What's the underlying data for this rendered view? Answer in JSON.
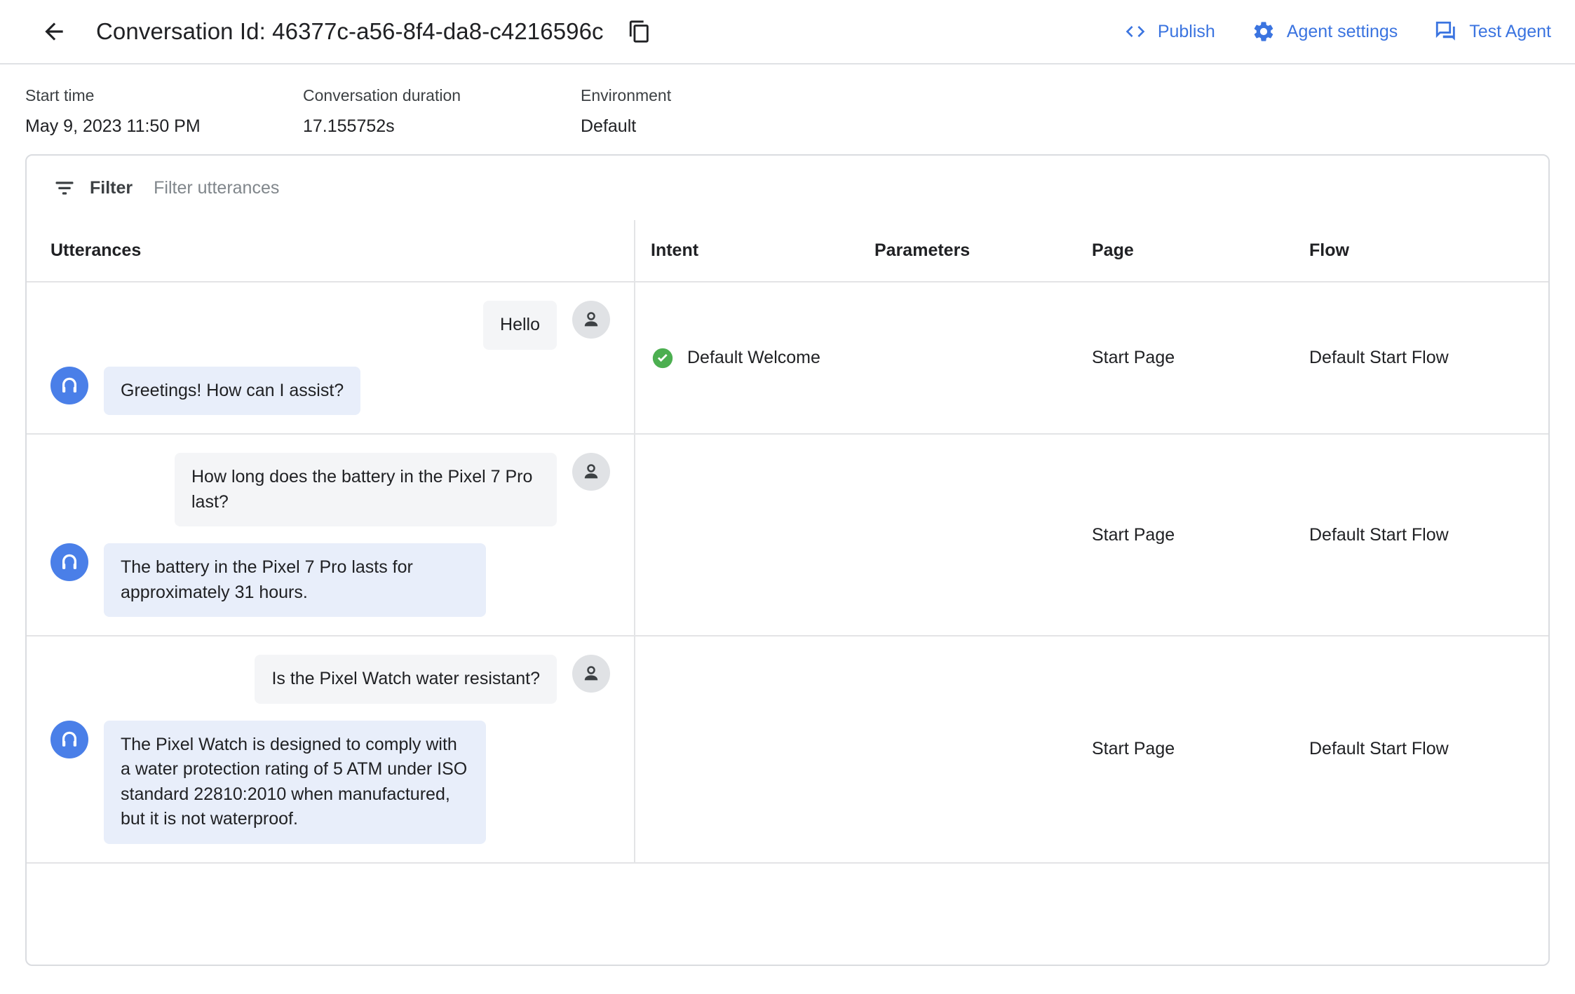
{
  "header": {
    "back_label": "Back",
    "title": "Conversation Id: 46377c-a56-8f4-da8-c4216596c",
    "copy_label": "Copy conversation id",
    "actions": [
      {
        "label": "Publish",
        "icon": "code-brackets-icon"
      },
      {
        "label": "Agent settings",
        "icon": "gear-icon"
      },
      {
        "label": "Test Agent",
        "icon": "chat-bubbles-icon"
      }
    ],
    "accent_color": "#3b74e0"
  },
  "meta": [
    {
      "label": "Start time",
      "value": "May 9, 2023 11:50 PM"
    },
    {
      "label": "Conversation duration",
      "value": "17.155752s"
    },
    {
      "label": "Environment",
      "value": "Default"
    }
  ],
  "filter": {
    "label": "Filter",
    "placeholder": "Filter utterances",
    "value": "",
    "icon": "filter-icon"
  },
  "table": {
    "columns": [
      "Utterances",
      "Intent",
      "Parameters",
      "Page",
      "Flow"
    ],
    "rows": [
      {
        "turns": [
          {
            "speaker": "user",
            "text": "Hello"
          },
          {
            "speaker": "agent",
            "text": "Greetings! How can I assist?"
          }
        ],
        "intent": "Default Welcome",
        "intent_status": "matched",
        "intent_status_color": "#4caf50",
        "parameters": "",
        "page": "Start Page",
        "flow": "Default Start Flow"
      },
      {
        "turns": [
          {
            "speaker": "user",
            "text": "How long does the battery in the Pixel 7 Pro last?"
          },
          {
            "speaker": "agent",
            "text": "The battery in the Pixel 7 Pro lasts for approximately 31 hours."
          }
        ],
        "intent": "",
        "intent_status": "none",
        "intent_status_color": "",
        "parameters": "",
        "page": "Start Page",
        "flow": "Default Start Flow"
      },
      {
        "turns": [
          {
            "speaker": "user",
            "text": "Is the Pixel Watch water resistant?"
          },
          {
            "speaker": "agent",
            "text": "The Pixel Watch is designed to comply with a water protection rating of 5 ATM under ISO standard 22810:2010 when manufactured, but it is not waterproof."
          }
        ],
        "intent": "",
        "intent_status": "none",
        "intent_status_color": "",
        "parameters": "",
        "page": "Start Page",
        "flow": "Default Start Flow"
      }
    ]
  }
}
